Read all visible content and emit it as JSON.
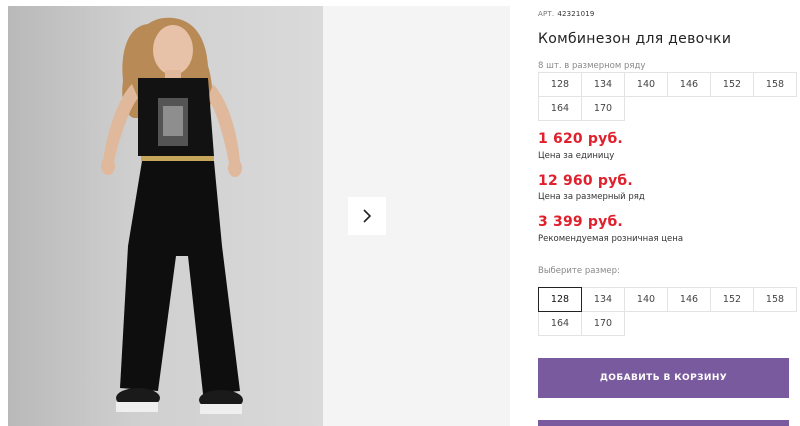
{
  "product": {
    "art_label": "АРТ.",
    "art_number": "42321019",
    "title": "Комбинезон для девочки"
  },
  "pack": {
    "caption": "8 шт. в размерном ряду",
    "sizes": [
      "128",
      "134",
      "140",
      "146",
      "152",
      "158",
      "164",
      "170"
    ]
  },
  "prices": {
    "unit_price": "1 620 руб.",
    "unit_caption": "Цена за единицу",
    "row_price": "12 960 руб.",
    "row_caption": "Цена за размерный ряд",
    "retail_price": "3 399 руб.",
    "retail_caption": "Рекомендуемая розничная цена"
  },
  "select_size": {
    "caption": "Выберите размер:",
    "sizes": [
      "128",
      "134",
      "140",
      "146",
      "152",
      "158",
      "164",
      "170"
    ],
    "selected": "128"
  },
  "actions": {
    "add_to_cart": "ДОБАВИТЬ В КОРЗИНУ"
  },
  "colors": {
    "price_red": "#e0202c",
    "button_purple": "#7a5a9e"
  },
  "icons": {
    "next": "chevron-right-icon"
  }
}
